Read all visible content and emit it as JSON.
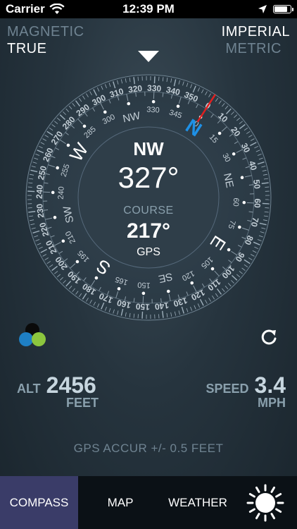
{
  "status_bar": {
    "carrier": "Carrier",
    "time": "12:39 PM",
    "battery_level": 0.85
  },
  "mode": {
    "magnetic": "MAGNETIC",
    "true": "TRUE",
    "imperial": "IMPERIAL",
    "metric": "METRIC"
  },
  "heading": {
    "direction": "NW",
    "degrees": "327°"
  },
  "course": {
    "label": "COURSE",
    "degrees": "217°",
    "source": "GPS"
  },
  "compass": {
    "rotation_deg": -327,
    "outer_numbers": [
      "0",
      "10",
      "20",
      "30",
      "40",
      "50",
      "60",
      "70",
      "80",
      "90",
      "100",
      "110",
      "120",
      "130",
      "140",
      "150",
      "160",
      "170",
      "180",
      "190",
      "200",
      "210",
      "220",
      "230",
      "240",
      "250",
      "260",
      "270",
      "280",
      "290",
      "300",
      "310",
      "320",
      "330",
      "340",
      "350"
    ],
    "inner_numbers": [
      "15",
      "30",
      "60",
      "75",
      "105",
      "120",
      "150",
      "165",
      "195",
      "210",
      "240",
      "255",
      "285",
      "300",
      "330",
      "345"
    ],
    "inner_0": "0",
    "cardinals": {
      "n": "N",
      "e": "E",
      "s": "S",
      "w": "W"
    },
    "intercardinals": {
      "ne": "NE",
      "se": "SE",
      "sw": "SW",
      "nw": "NW"
    },
    "colors": {
      "north": "#1e90e6",
      "needle": "#e02020"
    }
  },
  "altitude": {
    "label": "ALT",
    "value": "2456",
    "unit": "FEET"
  },
  "speed": {
    "label": "SPEED",
    "value": "3.4",
    "unit": "MPH"
  },
  "gps_accuracy": "GPS  ACCUR +/- 0.5 FEET",
  "tabs": {
    "compass": "COMPASS",
    "map": "MAP",
    "weather": "WEATHER"
  },
  "colors": {
    "active_tab": "#3a3c68",
    "tab_bar": "#0b1116"
  }
}
